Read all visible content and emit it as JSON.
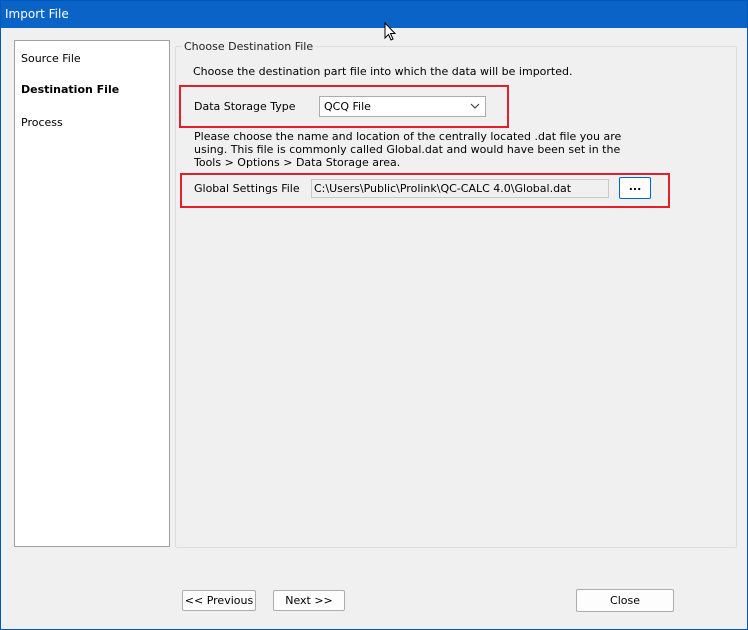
{
  "window": {
    "title": "Import File"
  },
  "nav": {
    "items": [
      {
        "label": "Source File"
      },
      {
        "label": "Destination File"
      },
      {
        "label": "Process"
      }
    ]
  },
  "group": {
    "legend": "Choose Destination File",
    "instruction": "Choose the destination part file into which the data will be imported.",
    "storage_type_label": "Data Storage Type",
    "storage_type_value": "QCQ File",
    "description": "Please choose the name and location of the centrally located .dat file you are using. This file is commonly called Global.dat and would have been set in the Tools > Options > Data Storage area.",
    "global_settings_label": "Global Settings File",
    "global_settings_path": "C:\\Users\\Public\\Prolink\\QC-CALC 4.0\\Global.dat",
    "browse_label": "..."
  },
  "buttons": {
    "previous": "<< Previous",
    "next": "Next >>",
    "close": "Close"
  },
  "colors": {
    "titlebar": "#0a64c8",
    "highlight": "#e0202a"
  }
}
